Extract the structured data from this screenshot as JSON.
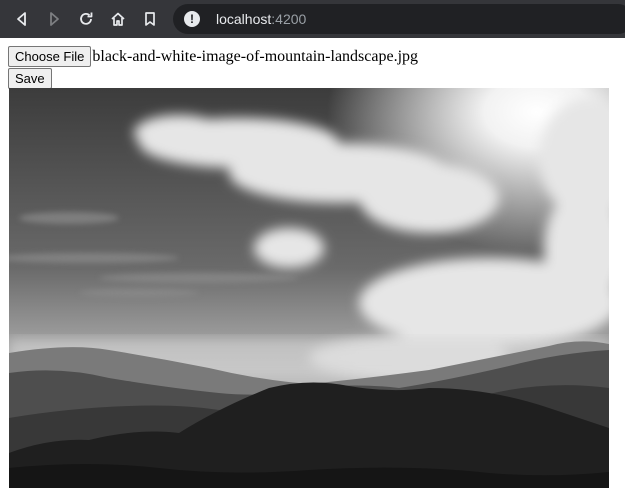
{
  "browser": {
    "url_host": "localhost",
    "url_port": ":4200",
    "icons": [
      "back-icon",
      "forward-icon",
      "reload-icon",
      "home-icon",
      "bookmark-icon",
      "info-icon"
    ]
  },
  "page": {
    "choose_file_label": "Choose File",
    "file_name": "black-and-white-image-of-mountain-landscape.jpg",
    "save_label": "Save"
  }
}
